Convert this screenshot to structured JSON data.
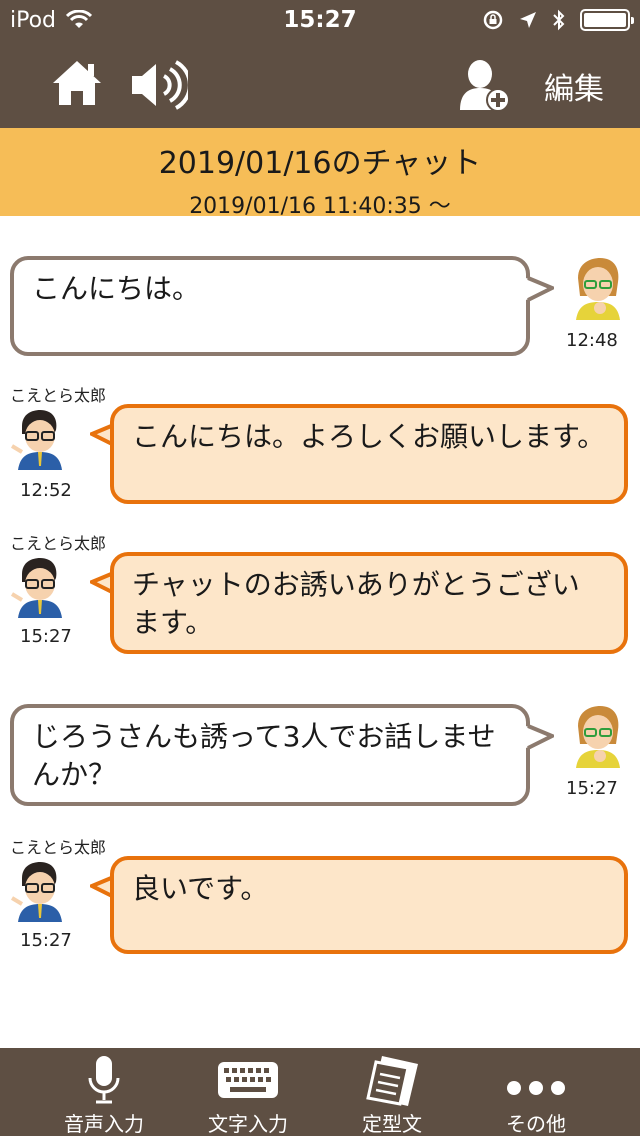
{
  "status_bar": {
    "carrier": "iPod",
    "time": "15:27"
  },
  "nav": {
    "edit_label": "編集"
  },
  "header": {
    "title": "2019/01/16のチャット",
    "subtitle": "2019/01/16 11:40:35 〜"
  },
  "messages": [
    {
      "side": "me",
      "text": "こんにちは。",
      "time": "12:48"
    },
    {
      "side": "them",
      "sender": "こえとら太郎",
      "text": "こんにちは。よろしくお願いします。",
      "time": "12:52"
    },
    {
      "side": "them",
      "sender": "こえとら太郎",
      "text": "チャットのお誘いありがとうございます。",
      "time": "15:27"
    },
    {
      "side": "me",
      "text": "じろうさんも誘って3人でお話しませんか？",
      "time": "15:27"
    },
    {
      "side": "them",
      "sender": "こえとら太郎",
      "text": "良いです。",
      "time": "15:27"
    }
  ],
  "tabs": [
    {
      "label": "音声入力",
      "icon": "microphone-icon"
    },
    {
      "label": "文字入力",
      "icon": "keyboard-icon"
    },
    {
      "label": "定型文",
      "icon": "template-document-icon"
    },
    {
      "label": "その他",
      "icon": "more-dots-icon"
    }
  ],
  "colors": {
    "bar": "#5e4f43",
    "header": "#f6bd57",
    "my_bubble_border": "#8c7a6e",
    "their_bubble_fill": "#fde6c9",
    "their_bubble_border": "#e8720c"
  }
}
